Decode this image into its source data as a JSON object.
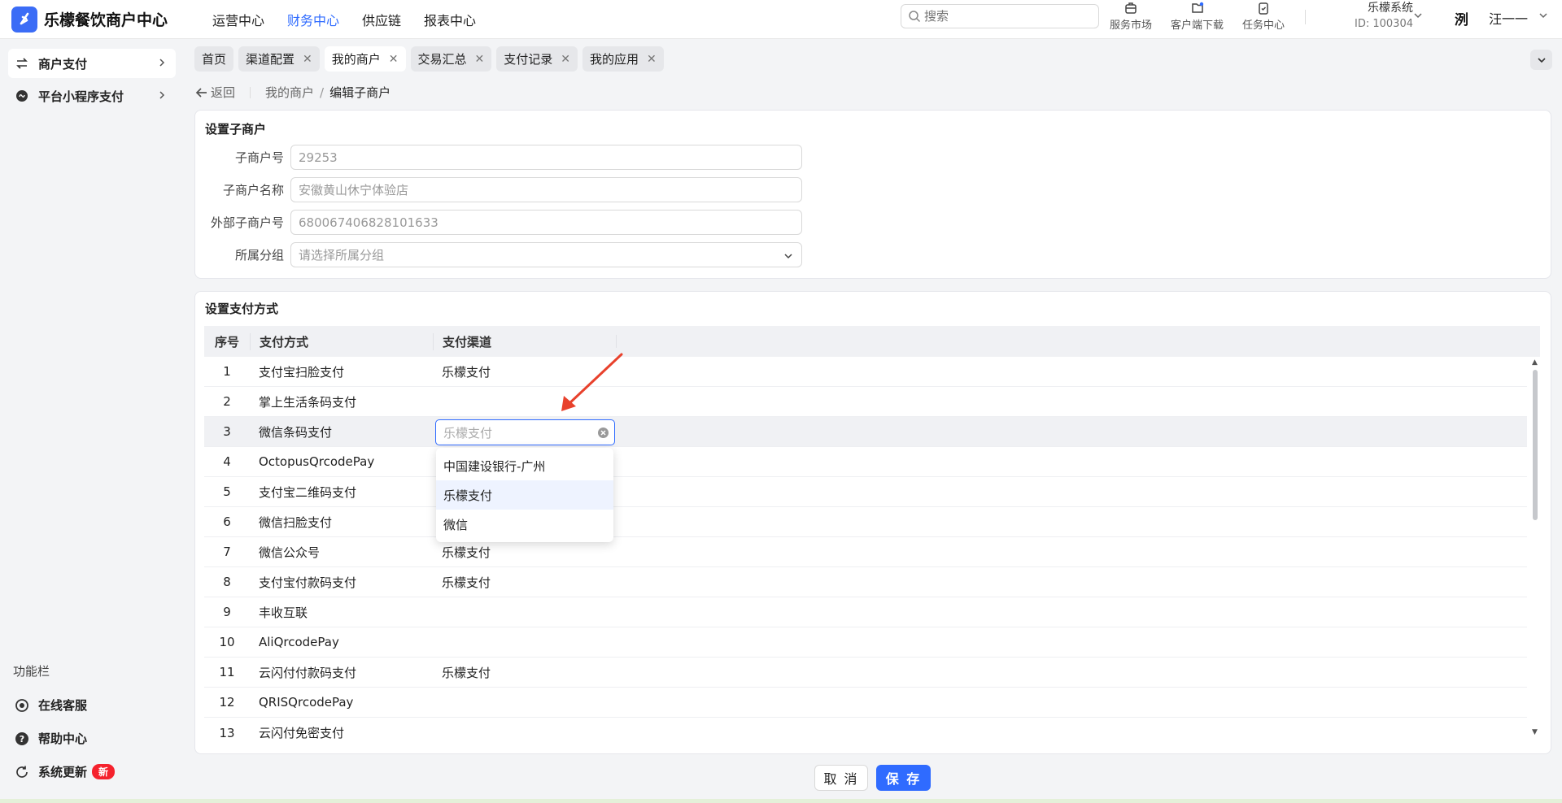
{
  "app": {
    "title": "乐檬餐饮商户中心",
    "brand_color": "#2f6bff"
  },
  "topnav": [
    {
      "label": "运营中心",
      "active": false
    },
    {
      "label": "财务中心",
      "active": true
    },
    {
      "label": "供应链",
      "active": false
    },
    {
      "label": "报表中心",
      "active": false
    }
  ],
  "search": {
    "placeholder": "搜索",
    "icon": "search-icon"
  },
  "tools": [
    {
      "label": "服务市场",
      "icon": "store-icon"
    },
    {
      "label": "客户端下载",
      "icon": "cloud-download-icon"
    },
    {
      "label": "任务中心",
      "icon": "clipboard-icon"
    }
  ],
  "system": {
    "name": "乐檬系统",
    "id": "ID: 100304"
  },
  "user": {
    "avatar_text": "洌",
    "name": "汪一一"
  },
  "sidebar": {
    "items": [
      {
        "label": "商户支付",
        "icon": "exchange-icon",
        "active": true
      },
      {
        "label": "平台小程序支付",
        "icon": "mini-program-icon",
        "active": false
      }
    ],
    "section_title": "功能栏",
    "footer": [
      {
        "label": "在线客服",
        "icon": "headset-icon"
      },
      {
        "label": "帮助中心",
        "icon": "help-icon"
      },
      {
        "label": "系统更新",
        "icon": "refresh-icon",
        "badge": "新"
      }
    ]
  },
  "tabs": [
    {
      "label": "首页",
      "closable": false,
      "active": false
    },
    {
      "label": "渠道配置",
      "closable": true,
      "active": false
    },
    {
      "label": "我的商户",
      "closable": true,
      "active": true
    },
    {
      "label": "交易汇总",
      "closable": true,
      "active": false
    },
    {
      "label": "支付记录",
      "closable": true,
      "active": false
    },
    {
      "label": "我的应用",
      "closable": true,
      "active": false
    }
  ],
  "breadcrumb": {
    "back": "返回",
    "parent": "我的商户",
    "separator": "/",
    "current": "编辑子商户"
  },
  "merchant_form": {
    "title": "设置子商户",
    "fields": [
      {
        "label": "子商户号",
        "value": "29253"
      },
      {
        "label": "子商户名称",
        "value": "安徽黄山休宁体验店"
      },
      {
        "label": "外部子商户号",
        "value": "680067406828101633"
      },
      {
        "label": "所属分组",
        "value": "请选择所属分组"
      }
    ]
  },
  "payment": {
    "title": "设置支付方式",
    "columns": [
      "序号",
      "支付方式",
      "支付渠道"
    ],
    "rows": [
      {
        "no": "1",
        "method": "支付宝扫脸支付",
        "channel": "乐檬支付"
      },
      {
        "no": "2",
        "method": "掌上生活条码支付",
        "channel": ""
      },
      {
        "no": "3",
        "method": "微信条码支付",
        "channel": ""
      },
      {
        "no": "4",
        "method": "OctopusQrcodePay",
        "channel": ""
      },
      {
        "no": "5",
        "method": "支付宝二维码支付",
        "channel": ""
      },
      {
        "no": "6",
        "method": "微信扫脸支付",
        "channel": ""
      },
      {
        "no": "7",
        "method": "微信公众号",
        "channel": "乐檬支付"
      },
      {
        "no": "8",
        "method": "支付宝付款码支付",
        "channel": "乐檬支付"
      },
      {
        "no": "9",
        "method": "丰收互联",
        "channel": ""
      },
      {
        "no": "10",
        "method": "AliQrcodePay",
        "channel": ""
      },
      {
        "no": "11",
        "method": "云闪付付款码支付",
        "channel": "乐檬支付"
      },
      {
        "no": "12",
        "method": "QRISQrcodePay",
        "channel": ""
      },
      {
        "no": "13",
        "method": "云闪付免密支付",
        "channel": ""
      }
    ],
    "editing_row": "3",
    "editing_placeholder": "乐檬支付",
    "dropdown": [
      {
        "label": "中国建设银行-广州",
        "selected": false
      },
      {
        "label": "乐檬支付",
        "selected": true
      },
      {
        "label": "微信",
        "selected": false
      }
    ]
  },
  "actions": {
    "cancel": "取 消",
    "save": "保 存"
  }
}
